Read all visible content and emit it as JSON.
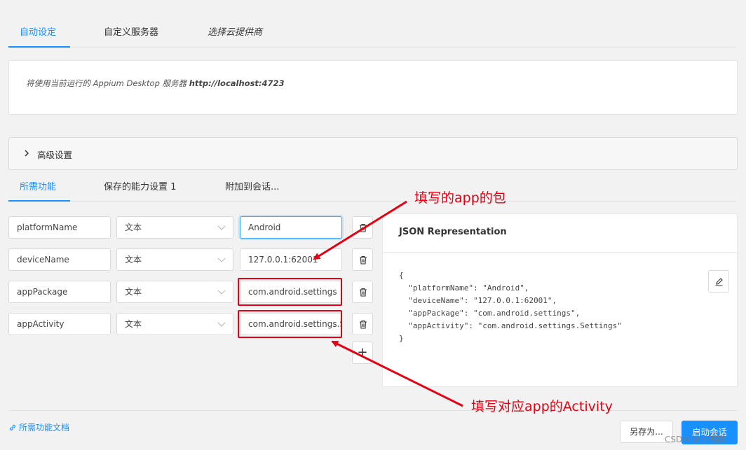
{
  "server_tabs": [
    {
      "label": "自动设定",
      "active": true
    },
    {
      "label": "自定义服务器",
      "active": false
    },
    {
      "label": "选择云提供商",
      "active": false
    }
  ],
  "server_info": {
    "prefix": "将使用当前运行的 Appium Desktop 服务器",
    "url": "http://localhost:4723"
  },
  "advanced": {
    "label": "高级设置"
  },
  "capability_tabs": [
    {
      "label": "所需功能",
      "active": true
    },
    {
      "label": "保存的能力设置 1",
      "active": false
    },
    {
      "label": "附加到会话...",
      "active": false
    }
  ],
  "capabilities": [
    {
      "name": "platformName",
      "type": "文本",
      "value": "Android"
    },
    {
      "name": "deviceName",
      "type": "文本",
      "value": "127.0.0.1:62001"
    },
    {
      "name": "appPackage",
      "type": "文本",
      "value": "com.android.settings"
    },
    {
      "name": "appActivity",
      "type": "文本",
      "value": "com.android.settings.Settings"
    }
  ],
  "json_panel": {
    "title": "JSON Representation",
    "lines": [
      "{",
      "  \"platformName\": \"Android\",",
      "  \"deviceName\": \"127.0.0.1:62001\",",
      "  \"appPackage\": \"com.android.settings\",",
      "  \"appActivity\": \"com.android.settings.Settings\"",
      "}"
    ]
  },
  "footer": {
    "doc_link": "所需功能文档",
    "save_as": "另存为...",
    "start_session": "启动会话"
  },
  "annotations": {
    "package_note": "填写的app的包",
    "activity_note": "填写对应app的Activity"
  },
  "watermark": "CSDN @小明糊",
  "colors": {
    "accent": "#1890ff",
    "annotation": "#e60012",
    "background": "#f2f2f2"
  },
  "icons": [
    "chevron-right-icon",
    "chevron-down-icon",
    "trash-icon",
    "plus-icon",
    "edit-icon",
    "link-icon"
  ]
}
